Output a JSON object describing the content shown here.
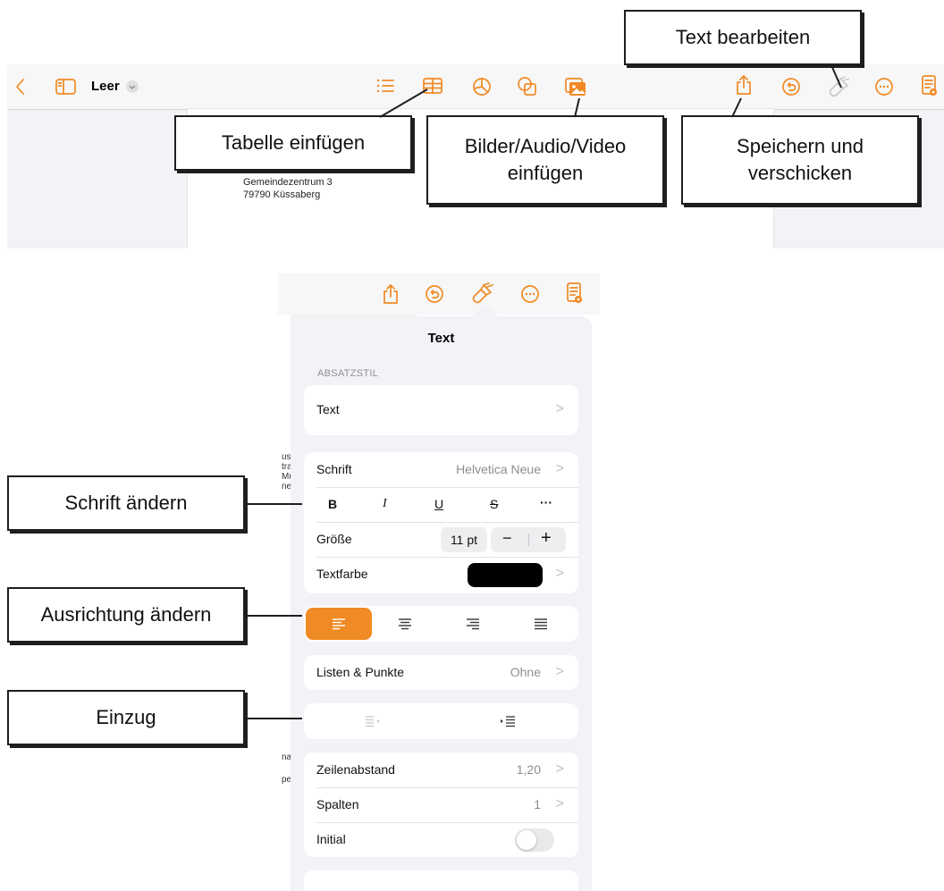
{
  "toolbar": {
    "document_name": "Leer",
    "colors": {
      "accent": "#f08a24"
    }
  },
  "document": {
    "line1": "Gemeindezentrum 3",
    "line2": "79790 Küssaberg"
  },
  "callouts": {
    "text_bearbeiten": "Text bearbeiten",
    "tabelle_einfuegen": "Tabelle einfügen",
    "bilder_audio_video_l1": "Bilder/Audio/Video",
    "bilder_audio_video_l2": "einfügen",
    "speichern_l1": "Speichern und",
    "speichern_l2": "verschicken",
    "schrift_aendern": "Schrift ändern",
    "ausrichtung_aendern": "Ausrichtung ändern",
    "einzug": "Einzug"
  },
  "panel": {
    "title": "Text",
    "section_header": "ABSATZSTIL",
    "paragraph_style": "Text",
    "font_label": "Schrift",
    "font_value": "Helvetica Neue",
    "style_buttons": {
      "bold": "B",
      "italic": "I",
      "underline": "U",
      "strike": "S",
      "more": "···"
    },
    "size_label": "Größe",
    "size_value": "11 pt",
    "minus": "−",
    "plus": "+",
    "color_label": "Textfarbe",
    "text_color": "#000000",
    "lists_label": "Listen & Punkte",
    "lists_value": "Ohne",
    "line_spacing_label": "Zeilenabstand",
    "line_spacing_value": "1,20",
    "columns_label": "Spalten",
    "columns_value": "1",
    "dropcap_label": "Initial",
    "dropcap_on": false,
    "selected_alignment": "left",
    "chevron": ">"
  },
  "bg_doc_fragments": [
    "ust",
    "tra",
    "Mu",
    "ne",
    "nar",
    "pe"
  ]
}
